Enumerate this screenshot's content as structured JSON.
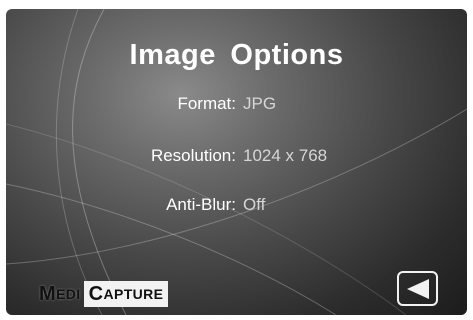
{
  "screen": {
    "title": "Image Options",
    "options": [
      {
        "label": "Format:",
        "value": "JPG"
      },
      {
        "label": "Resolution:",
        "value": "1024 x 768"
      },
      {
        "label": "Anti-Blur:",
        "value": "Off"
      }
    ]
  },
  "logo": {
    "part1_initial": "M",
    "part1_rest": "EDI",
    "part2_initial": "C",
    "part2_rest": "APTURE"
  },
  "controls": {
    "back_icon": "left-triangle-icon"
  },
  "colors": {
    "background_dark": "#1c1c1c",
    "background_light": "#8a8a8a",
    "text": "#ffffff",
    "value_text": "#d6d6d6"
  }
}
